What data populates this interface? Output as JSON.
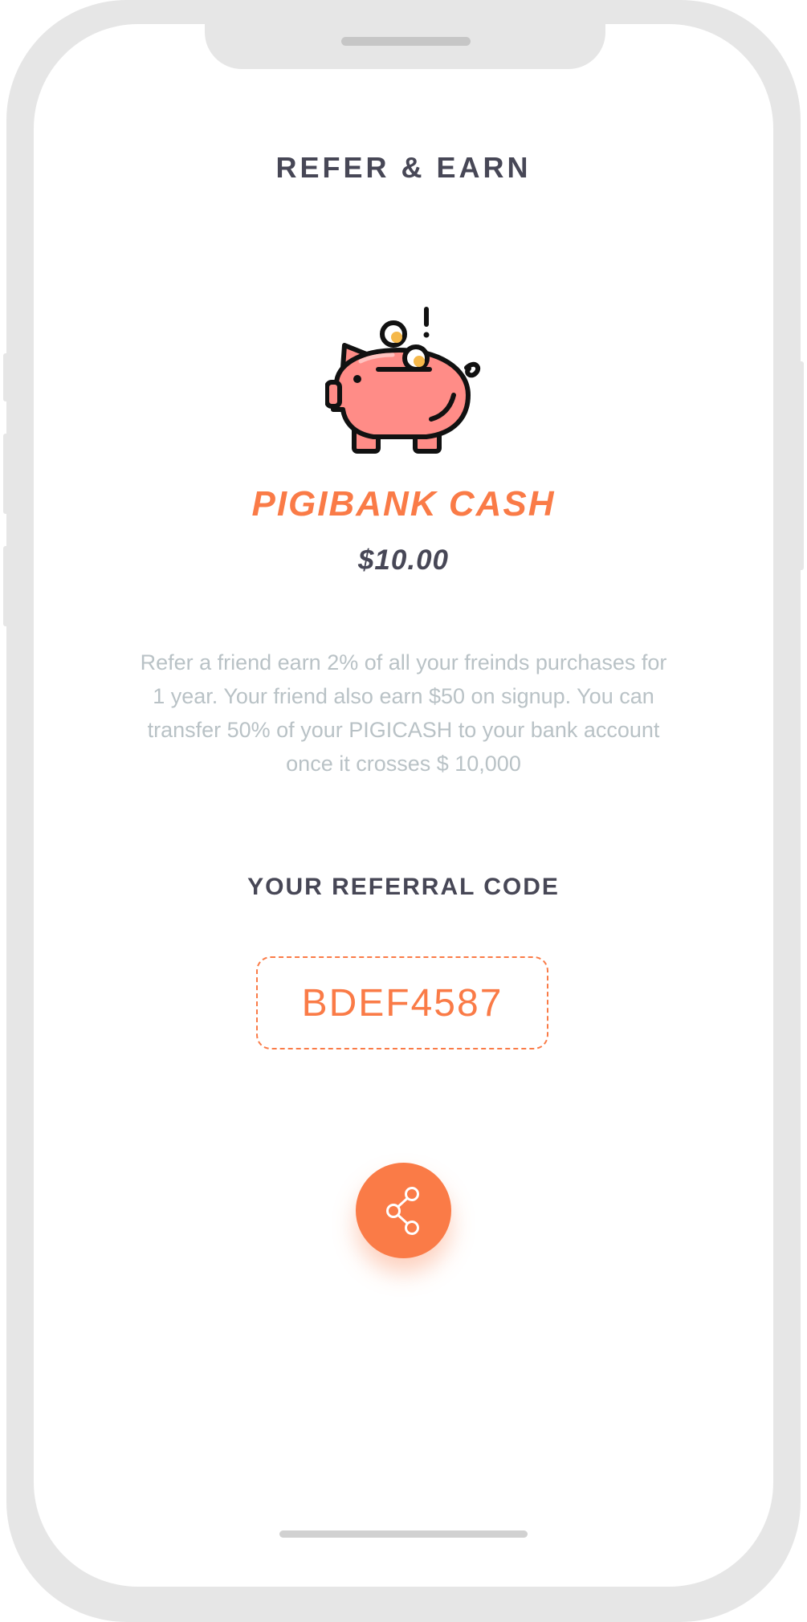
{
  "header": {
    "title": "REFER & EARN"
  },
  "wallet": {
    "icon": "piggy-bank-icon",
    "name": "PIGIBANK CASH",
    "balance": "$10.00"
  },
  "description": "Refer a friend earn 2% of all your freinds purchases for 1 year. Your friend also earn $50 on signup. You can transfer 50% of your PIGICASH to  your bank account once it crosses $ 10,000",
  "referral": {
    "label": "YOUR REFERRAL CODE",
    "code": "BDEF4587"
  },
  "share": {
    "icon": "share-icon"
  },
  "colors": {
    "accent": "#fa7b47",
    "heading": "#474756",
    "muted": "#b9c2c6",
    "device_frame": "#e6e6e6"
  }
}
